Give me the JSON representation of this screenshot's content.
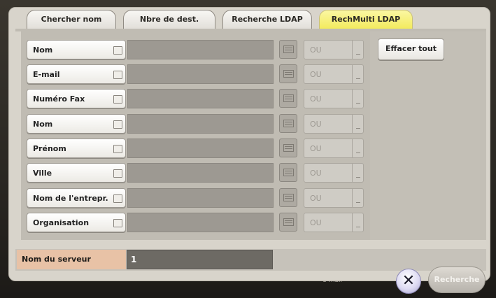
{
  "tabs": [
    {
      "label": "Chercher nom",
      "active": false
    },
    {
      "label": "Nbre de dest.",
      "active": false
    },
    {
      "label": "Recherche LDAP",
      "active": false
    },
    {
      "label": "RechMulti LDAP",
      "active": true
    }
  ],
  "search_rows": [
    {
      "label": "Nom",
      "checked": false,
      "value": "",
      "operator": "OU"
    },
    {
      "label": "E-mail",
      "checked": false,
      "value": "",
      "operator": "OU"
    },
    {
      "label": "Numéro Fax",
      "checked": false,
      "value": "",
      "operator": "OU"
    },
    {
      "label": "Nom",
      "checked": false,
      "value": "",
      "operator": "OU"
    },
    {
      "label": "Prénom",
      "checked": false,
      "value": "",
      "operator": "OU"
    },
    {
      "label": "Ville",
      "checked": false,
      "value": "",
      "operator": "OU"
    },
    {
      "label": "Nom de l'entrepr.",
      "checked": false,
      "value": "",
      "operator": "OU"
    },
    {
      "label": "Organisation",
      "checked": false,
      "value": "",
      "operator": "OU"
    }
  ],
  "actions": {
    "clear_all_label": "Effacer tout"
  },
  "server": {
    "label": "Nom du serveur",
    "value": "1"
  },
  "footer": {
    "search_label": "Recherche",
    "close_symbol": "✕"
  },
  "background": {
    "partial_label": "e-mail"
  },
  "icons": {
    "keyboard": "keyboard-icon",
    "close": "close-icon",
    "checkbox": "checkbox-icon",
    "dropdown": "chevron-down-icon"
  },
  "colors": {
    "active_tab": "#f2ea5b",
    "server_label_bg": "#e8c2a6",
    "server_field_bg": "#6d6a64",
    "close_button": "#dedbf3"
  }
}
